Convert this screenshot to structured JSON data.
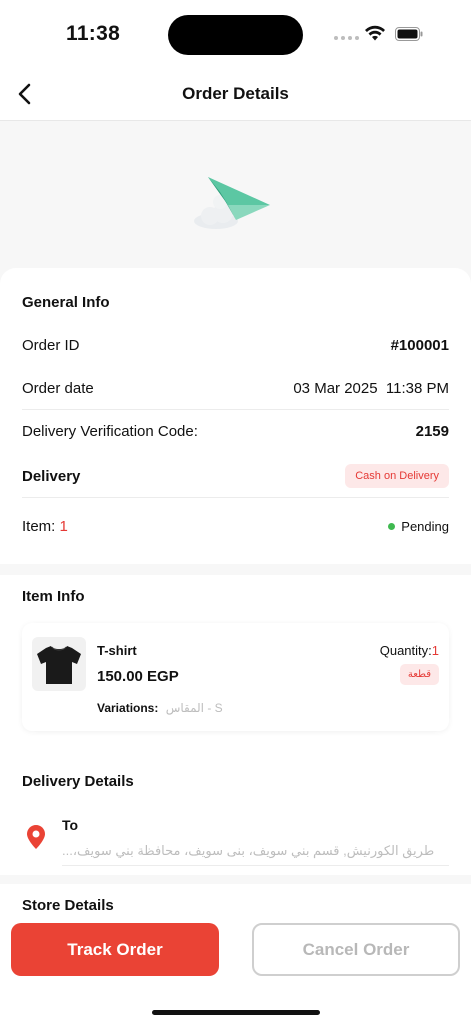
{
  "status_bar": {
    "time": "11:38"
  },
  "nav": {
    "title": "Order Details"
  },
  "general_info": {
    "title": "General Info",
    "order_id_label": "Order ID",
    "order_id_value": "#100001",
    "order_date_label": "Order date",
    "order_date_value": "03 Mar 2025  11:38 PM",
    "verification_label": "Delivery Verification Code:",
    "verification_value": "2159",
    "delivery_label": "Delivery",
    "payment_badge": "Cash on Delivery",
    "item_label": "Item:",
    "item_count": "1",
    "status": "Pending"
  },
  "item_info": {
    "title": "Item Info",
    "name": "T-shirt",
    "price": "150.00 EGP",
    "variations_label": "Variations:",
    "variations_value": "المقاس - S",
    "quantity_label": "Quantity:",
    "quantity_value": "1",
    "unit_badge": "قطعة"
  },
  "delivery_details": {
    "title": "Delivery Details",
    "to_label": "To",
    "address": "طريق الكورنيش, قسم بني سويف، بنى سويف، محافظة بني سويف،..."
  },
  "store_details": {
    "title": "Store Details"
  },
  "actions": {
    "track_label": "Track Order",
    "cancel_label": "Cancel Order"
  },
  "colors": {
    "accent": "#ea4335",
    "status_pending": "#3fb950",
    "badge_bg": "#fde8e8"
  },
  "icons": {
    "back": "chevron-left-icon",
    "hero": "paper-plane-icon",
    "location": "location-pin-icon",
    "thumb": "t-shirt-icon"
  }
}
